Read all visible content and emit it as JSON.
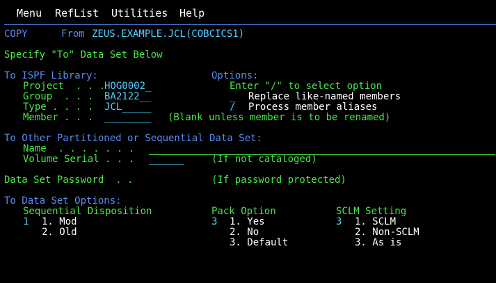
{
  "menu": {
    "items": [
      "Menu",
      "RefList",
      "Utilities",
      "Help"
    ]
  },
  "header": {
    "action": "COPY",
    "from_label": "From",
    "from_dataset": "ZEUS.EXAMPLE.JCL(COBCICS1)"
  },
  "instruction": "Specify \"To\" Data Set Below",
  "isp_library": {
    "heading": "To ISPF Library:",
    "project_label": "Project  . . .",
    "project_value": "HOG0002_",
    "group_label": "Group  . . .",
    "group_value": "BA2122__",
    "type_label": "Type . . . .",
    "type_value": "JCL_____",
    "member_label": "Member . . .",
    "member_value": "________",
    "member_note": "(Blank unless member is to be renamed)"
  },
  "options": {
    "heading": "Options:",
    "hint": "Enter \"/\" to select option",
    "replace_value": "_",
    "replace_label": "Replace like-named members",
    "alias_value": "/",
    "alias_label": "Process member aliases"
  },
  "other_dataset": {
    "heading": "To Other Partitioned or Sequential Data Set:",
    "name_label": "Name  . . . . . . .",
    "volume_label": "Volume Serial . . .",
    "volume_value": "______",
    "volume_note": "(If not cataloged)"
  },
  "password": {
    "label": "Data Set Password  . .",
    "note": "(If password protected)"
  },
  "ds_options": {
    "heading": "To Data Set Options:",
    "seq_heading": "Sequential Disposition",
    "seq_selected": "1",
    "seq_opt1": "1. Mod",
    "seq_opt2": "2. Old",
    "pack_heading": "Pack Option",
    "pack_selected": "3",
    "pack_opt1": "1. Yes",
    "pack_opt2": "2. No",
    "pack_opt3": "3. Default",
    "sclm_heading": "SCLM Setting",
    "sclm_selected": "3",
    "sclm_opt1": "1. SCLM",
    "sclm_opt2": "2. Non-SCLM",
    "sclm_opt3": "3. As is"
  },
  "colors": {
    "background": "#000000",
    "label_blue": "#5a8cf0",
    "text_green": "#46e946",
    "input_cyan": "#4fd1ff",
    "menu_white": "#ffffff"
  }
}
